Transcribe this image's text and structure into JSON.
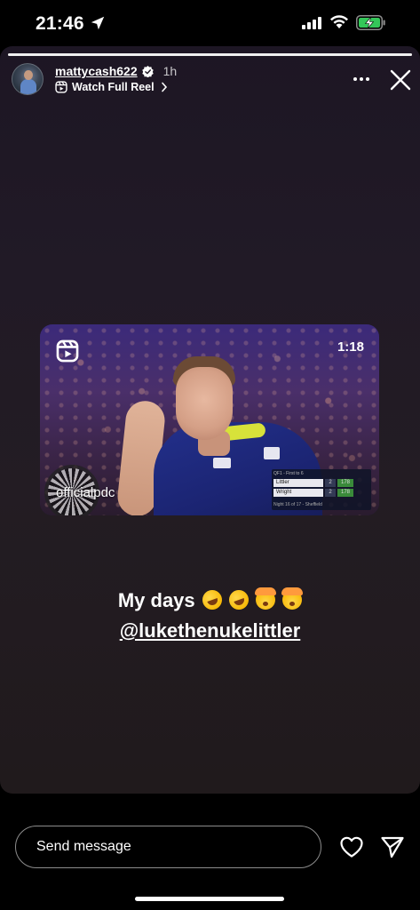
{
  "status_bar": {
    "time": "21:46",
    "icons": [
      "location-arrow-icon",
      "cellular-signal-icon",
      "wifi-icon",
      "battery-charging-icon"
    ],
    "battery_color": "#34c759"
  },
  "story": {
    "progress": 1.0,
    "username": "mattycash622",
    "verified_icon": "verified-badge-icon",
    "time_ago": "1h",
    "reel_link": "Watch Full Reel",
    "menu_icon": "more-horizontal-icon",
    "close_icon": "close-icon"
  },
  "reel_card": {
    "icon": "reels-icon",
    "duration": "1:18",
    "author": "officialpdc",
    "scoreboard": {
      "header": "QF1 - First to 6",
      "rows": [
        {
          "name": "Littler",
          "legs": "2",
          "score": "178"
        },
        {
          "name": "Wright",
          "legs": "2",
          "score": "178"
        }
      ],
      "footer": "Night 16 of 17 - Sheffield"
    }
  },
  "caption": {
    "line1": "My days",
    "emojis": [
      "rolling-on-floor-laughing-emoji",
      "rolling-on-floor-laughing-emoji",
      "exploding-head-emoji",
      "exploding-head-emoji"
    ],
    "mention": "@lukethenukelittler"
  },
  "reply_bar": {
    "placeholder": "Send message",
    "like_icon": "heart-icon",
    "share_icon": "send-paper-plane-icon"
  }
}
